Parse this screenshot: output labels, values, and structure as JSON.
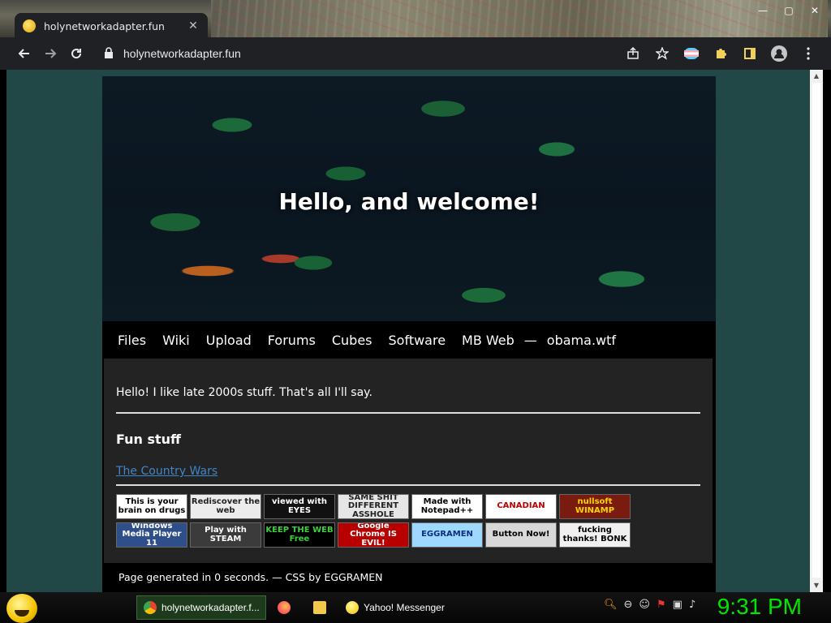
{
  "browser": {
    "tab_title": "holynetworkadapter.fun",
    "tab_close": "✕",
    "url": "holynetworkadapter.fun",
    "window_controls": [
      "—",
      "▢",
      "✕"
    ]
  },
  "page": {
    "hero_title": "Hello, and welcome!",
    "nav": [
      "Files",
      "Wiki",
      "Upload",
      "Forums",
      "Cubes",
      "Software",
      "MB Web"
    ],
    "nav_separator": "—",
    "nav_extra": "obama.wtf",
    "intro": "Hello! I like late 2000s stuff. That's all I'll say.",
    "fun_heading": "Fun stuff",
    "fun_link": "The Country Wars",
    "badges": [
      {
        "text": "This is your brain on drugs",
        "bg": "#ffffff",
        "fg": "#000000"
      },
      {
        "text": "Rediscover the web",
        "bg": "#ececec",
        "fg": "#222222"
      },
      {
        "text": "viewed with EYES",
        "bg": "#111111",
        "fg": "#ffffff"
      },
      {
        "text": "SAME SHIT DIFFERENT ASSHOLE",
        "bg": "#e6e6e6",
        "fg": "#222222"
      },
      {
        "text": "Made with Notepad++",
        "bg": "#ffffff",
        "fg": "#000000"
      },
      {
        "text": "CANADIAN",
        "bg": "#ffffff",
        "fg": "#c00000"
      },
      {
        "text": "nullsoft WINAMP",
        "bg": "#7a1b10",
        "fg": "#ffd200"
      },
      {
        "text": "Windows Media Player 11",
        "bg": "#2f4f8a",
        "fg": "#ffffff"
      },
      {
        "text": "Play with STEAM",
        "bg": "#3b3b3b",
        "fg": "#ffffff"
      },
      {
        "text": "KEEP THE WEB Free",
        "bg": "#000000",
        "fg": "#39d239"
      },
      {
        "text": "Google Chrome IS EVIL!",
        "bg": "#b80000",
        "fg": "#ffffff"
      },
      {
        "text": "EGGRAMEN",
        "bg": "#9fd8ff",
        "fg": "#0a2f80"
      },
      {
        "text": "Button Now!",
        "bg": "#d8d8d8",
        "fg": "#000000"
      },
      {
        "text": "fucking thanks! BONK",
        "bg": "#f0f0f0",
        "fg": "#000000"
      }
    ],
    "footer": "Page generated in 0 seconds. — CSS by EGGRAMEN"
  },
  "taskbar": {
    "tasks": [
      "holynetworkadapter.f...",
      "",
      "",
      "Yahoo! Messenger"
    ],
    "clock": "9:31 PM"
  },
  "colors": {
    "background": "#224747",
    "link": "#3f86c9",
    "clock": "#00e600"
  }
}
